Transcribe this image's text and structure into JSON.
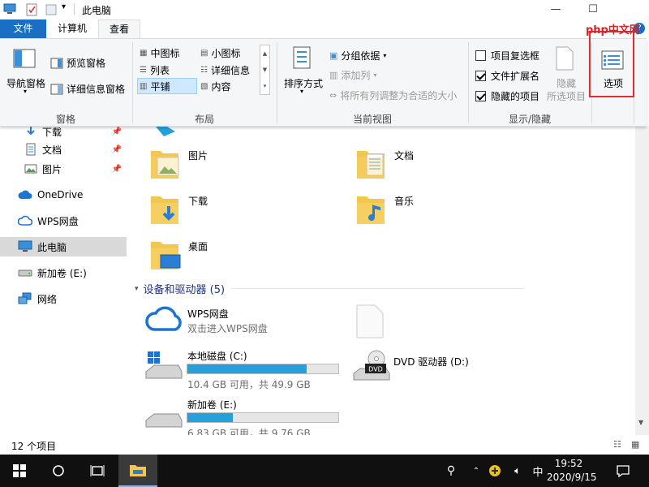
{
  "window": {
    "title": "此电脑"
  },
  "ribbon": {
    "tabs": [
      "文件",
      "计算机",
      "查看"
    ],
    "panes": {
      "nav_pane": "导航窗格",
      "preview_pane": "预览窗格",
      "details_pane": "详细信息窗格",
      "group": "窗格"
    },
    "layout": {
      "medium_icons": "中图标",
      "small_icons": "小图标",
      "list": "列表",
      "details": "详细信息",
      "tiles": "平铺",
      "content": "内容",
      "group": "布局"
    },
    "current_view": {
      "sort_by": "排序方式",
      "group_by": "分组依据",
      "add_columns": "添加列",
      "size_all_columns": "将所有列调整为合适的大小",
      "group": "当前视图"
    },
    "show_hide": {
      "item_checkboxes": "项目复选框",
      "item_checkboxes_checked": false,
      "file_extensions": "文件扩展名",
      "file_extensions_checked": true,
      "hidden_items": "隐藏的项目",
      "hidden_items_checked": true,
      "hide_selected_line1": "隐藏",
      "hide_selected_line2": "所选项目",
      "group": "显示/隐藏"
    },
    "options": "选项"
  },
  "nav": {
    "items": [
      {
        "label": "下载",
        "pinned": true
      },
      {
        "label": "文档",
        "pinned": true
      },
      {
        "label": "图片",
        "pinned": true
      },
      {
        "label": "OneDrive"
      },
      {
        "label": "WPS网盘"
      },
      {
        "label": "此电脑",
        "selected": true
      },
      {
        "label": "新加卷 (E:)"
      },
      {
        "label": "网络"
      }
    ]
  },
  "folders": [
    {
      "label": "图片"
    },
    {
      "label": "文档"
    },
    {
      "label": "下载"
    },
    {
      "label": "音乐"
    },
    {
      "label": "桌面"
    }
  ],
  "devices": {
    "heading": "设备和驱动器 (5)",
    "wps": {
      "name": "WPS网盘",
      "subtitle": "双击进入WPS网盘"
    },
    "c_drive": {
      "name": "本地磁盘 (C:)",
      "space": "10.4 GB 可用，共 49.9 GB",
      "used_fraction": 0.79
    },
    "dvd": {
      "name": "DVD 驱动器 (D:)",
      "badge": "DVD"
    },
    "e_drive": {
      "name": "新加卷 (E:)",
      "space": "6.83 GB 可用，共 9.76 GB",
      "used_fraction": 0.3
    }
  },
  "status": {
    "item_count": "12 个项目"
  },
  "taskbar": {
    "time": "19:52",
    "date": "2020/9/15",
    "ime": "中"
  },
  "watermark": {
    "text": "php中文网"
  },
  "colors": {
    "accent": "#1a6fc4",
    "drive_fill": "#26a0da",
    "highlight": "#e62b2b"
  }
}
